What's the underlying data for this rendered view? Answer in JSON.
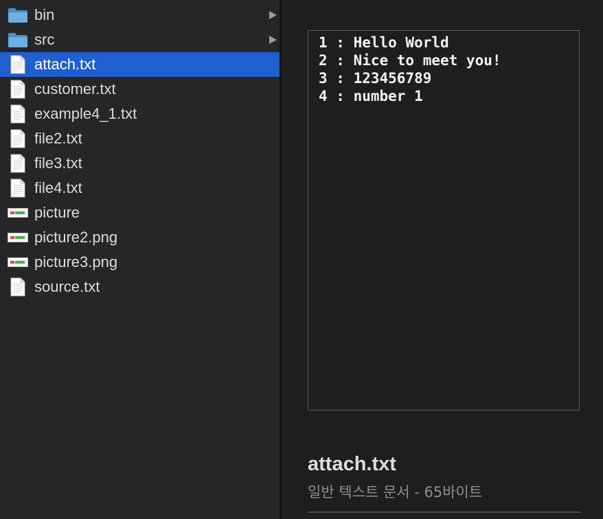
{
  "file_list": {
    "items": [
      {
        "name": "bin",
        "icon": "folder-icon",
        "has_children": true,
        "selected": false
      },
      {
        "name": "src",
        "icon": "folder-icon",
        "has_children": true,
        "selected": false
      },
      {
        "name": "attach.txt",
        "icon": "text-file-icon",
        "has_children": false,
        "selected": true
      },
      {
        "name": "customer.txt",
        "icon": "text-file-icon",
        "has_children": false,
        "selected": false
      },
      {
        "name": "example4_1.txt",
        "icon": "text-file-icon",
        "has_children": false,
        "selected": false
      },
      {
        "name": "file2.txt",
        "icon": "text-file-icon",
        "has_children": false,
        "selected": false
      },
      {
        "name": "file3.txt",
        "icon": "text-file-icon",
        "has_children": false,
        "selected": false
      },
      {
        "name": "file4.txt",
        "icon": "text-file-icon",
        "has_children": false,
        "selected": false
      },
      {
        "name": "picture",
        "icon": "image-file-icon",
        "has_children": false,
        "selected": false
      },
      {
        "name": "picture2.png",
        "icon": "image-file-icon",
        "has_children": false,
        "selected": false
      },
      {
        "name": "picture3.png",
        "icon": "image-file-icon",
        "has_children": false,
        "selected": false
      },
      {
        "name": "source.txt",
        "icon": "text-file-icon",
        "has_children": false,
        "selected": false
      }
    ]
  },
  "preview": {
    "lines": [
      "1 : Hello World",
      "2 : Nice to meet you!",
      "3 : 123456789",
      "4 : number 1"
    ],
    "file_name": "attach.txt",
    "file_info": "일반 텍스트 문서 - 65바이트"
  },
  "colors": {
    "selection": "#1f5fcf",
    "sidebar_background": "#252628",
    "preview_background": "#1e1e1e",
    "folder": "#5a9fd4"
  }
}
